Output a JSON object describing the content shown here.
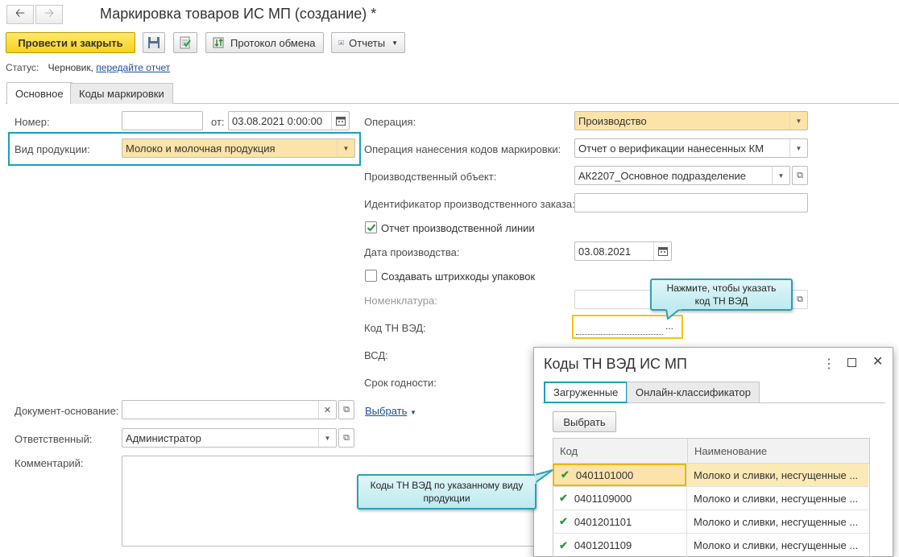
{
  "title": "Маркировка товаров ИС МП (создание) *",
  "toolbar": {
    "post_close": "Провести и закрыть",
    "exchange_log": "Протокол обмена",
    "reports": "Отчеты"
  },
  "status": {
    "label": "Статус:",
    "value": "Черновик,",
    "link": "передайте отчет"
  },
  "tabs": [
    "Основное",
    "Коды маркировки"
  ],
  "form": {
    "number_label": "Номер:",
    "number_value": "",
    "from_label": "от:",
    "date_value": "03.08.2021  0:00:00",
    "product_type_label": "Вид продукции:",
    "product_type_value": "Молоко и молочная продукция",
    "operation_label": "Операция:",
    "operation_value": "Производство",
    "marking_op_label": "Операция нанесения кодов маркировки:",
    "marking_op_value": "Отчет о верификации нанесенных КМ",
    "prod_object_label": "Производственный объект:",
    "prod_object_value": "АК2207_Основное подразделение",
    "order_id_label": "Идентификатор производственного заказа:",
    "order_id_value": "",
    "line_report_label": "Отчет производственной линии",
    "line_report_checked": true,
    "prod_date_label": "Дата производства:",
    "prod_date_value": "03.08.2021",
    "create_barcodes_label": "Создавать штрихкоды упаковок",
    "create_barcodes_checked": false,
    "nomenclature_label": "Номенклатура:",
    "tnved_label": "Код ТН ВЭД:",
    "tnved_btn": "...",
    "vsd_label": "ВСД:",
    "shelf_life_label": "Срок годности:",
    "base_doc_label": "Документ-основание:",
    "choose_link": "Выбрать",
    "responsible_label": "Ответственный:",
    "responsible_value": "Администратор",
    "comment_label": "Комментарий:"
  },
  "callouts": {
    "tnved_hint": "Нажмите, чтобы указать код ТН ВЭД",
    "codes_hint": "Коды ТН ВЭД по указанному виду продукции"
  },
  "popup": {
    "title": "Коды ТН ВЭД ИС МП",
    "tabs": [
      "Загруженные",
      "Онлайн-классификатор"
    ],
    "choose_btn": "Выбрать",
    "columns": [
      "Код",
      "Наименование"
    ],
    "rows": [
      {
        "code": "0401101000",
        "name": "Молоко и сливки, несгущенные ..."
      },
      {
        "code": "0401109000",
        "name": "Молоко и сливки, несгущенные ..."
      },
      {
        "code": "0401201101",
        "name": "Молоко и сливки, несгущенные ..."
      },
      {
        "code": "0401201109",
        "name": "Молоко и сливки, несгущенные ..."
      }
    ]
  },
  "colors": {
    "accent_yellow": "#f7d21d",
    "highlight_teal": "#1aa0b8",
    "field_yellow": "#fbe3a9",
    "link_blue": "#1d4e9c"
  }
}
